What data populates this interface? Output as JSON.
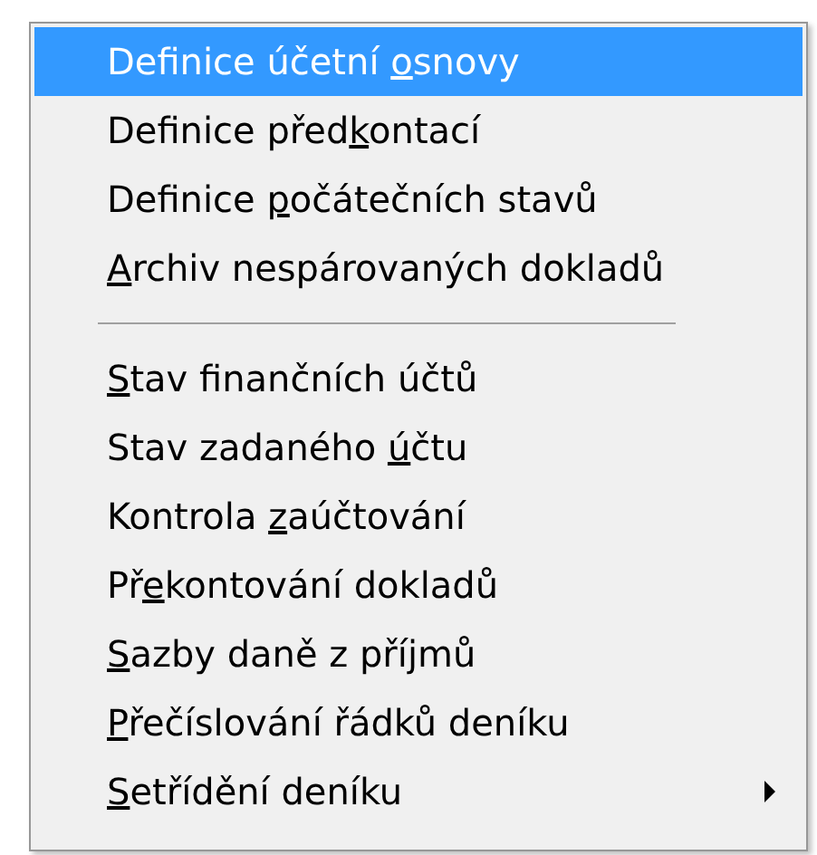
{
  "menu": {
    "items": [
      {
        "kind": "item",
        "before": "Definice účetní ",
        "key": "o",
        "after": "snovy",
        "selected": true,
        "submenu": false
      },
      {
        "kind": "item",
        "before": "Definice před",
        "key": "k",
        "after": "ontací",
        "selected": false,
        "submenu": false
      },
      {
        "kind": "item",
        "before": "Definice ",
        "key": "p",
        "after": "očátečních stavů",
        "selected": false,
        "submenu": false
      },
      {
        "kind": "item",
        "key": "A",
        "after": "rchiv nespárovaných dokladů",
        "selected": false,
        "submenu": false
      },
      {
        "kind": "separator"
      },
      {
        "kind": "item",
        "key": "S",
        "after": "tav finančních účtů",
        "selected": false,
        "submenu": false
      },
      {
        "kind": "item",
        "before": "Stav zadaného ",
        "key": "ú",
        "after": "čtu",
        "selected": false,
        "submenu": false
      },
      {
        "kind": "item",
        "before": "Kontrola ",
        "key": "z",
        "after": "aúčtování",
        "selected": false,
        "submenu": false
      },
      {
        "kind": "item",
        "before": "Př",
        "key": "e",
        "after": "kontování dokladů",
        "selected": false,
        "submenu": false
      },
      {
        "kind": "item",
        "key": "S",
        "after": "azby daně z příjmů",
        "selected": false,
        "submenu": false
      },
      {
        "kind": "item",
        "key": "P",
        "after": "řečíslování řádků deníku",
        "selected": false,
        "submenu": false
      },
      {
        "kind": "item",
        "key": "S",
        "after": "etřídění deníku",
        "selected": false,
        "submenu": true
      }
    ]
  }
}
